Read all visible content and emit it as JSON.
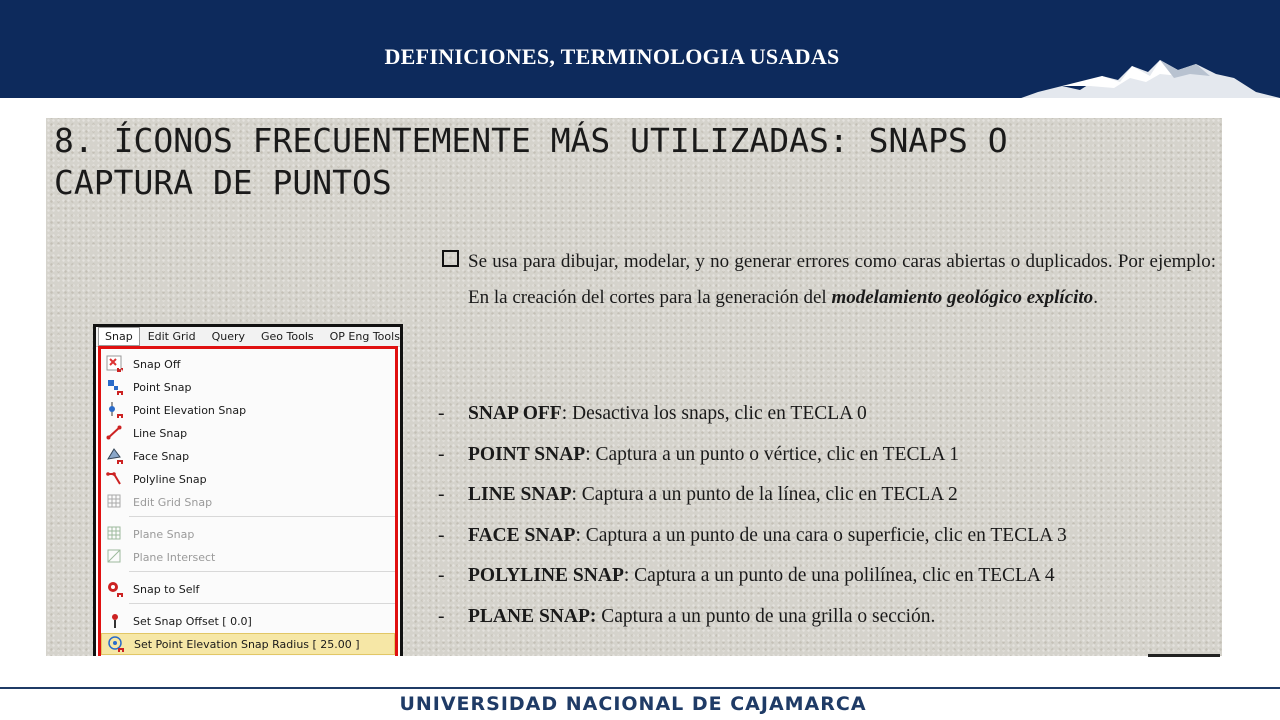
{
  "header": {
    "title": "DEFINICIONES, TERMINOLOGIA  USADAS"
  },
  "slide": {
    "title_line1": "8. ÍCONOS FRECUENTEMENTE MÁS UTILIZADAS: SNAPS O",
    "title_line2": "CAPTURA DE PUNTOS",
    "intro_prefix": "Se usa para dibujar, modelar, y no generar errores como caras abiertas o duplicados. Por ejemplo: En la creación del cortes para la generación del ",
    "intro_emph": "modelamiento geológico explícito",
    "intro_suffix": ".",
    "definitions": [
      {
        "term": "SNAP OFF",
        "desc": ": Desactiva los snaps, clic en TECLA 0"
      },
      {
        "term": "POINT SNAP",
        "desc": ": Captura a un punto o vértice, clic en TECLA 1"
      },
      {
        "term": "LINE SNAP",
        "desc": ": Captura a un punto de la línea, clic en TECLA 2"
      },
      {
        "term": "FACE SNAP",
        "desc": ": Captura a un punto de una cara o superficie, clic en TECLA 3"
      },
      {
        "term": "POLYLINE SNAP",
        "desc": ": Captura a un punto de una polilínea, clic en TECLA 4"
      },
      {
        "term": "PLANE SNAP:",
        "desc": " Captura a un punto de una grilla o sección."
      }
    ]
  },
  "menu": {
    "bar": [
      "Snap",
      "Edit Grid",
      "Query",
      "Geo Tools",
      "OP Eng Tools"
    ],
    "items": [
      {
        "label": "Snap Off",
        "icon": "snap-off-icon"
      },
      {
        "label": "Point Snap",
        "icon": "point-snap-icon"
      },
      {
        "label": "Point Elevation Snap",
        "icon": "point-elevation-snap-icon"
      },
      {
        "label": "Line Snap",
        "icon": "line-snap-icon"
      },
      {
        "label": "Face Snap",
        "icon": "face-snap-icon"
      },
      {
        "label": "Polyline Snap",
        "icon": "polyline-snap-icon"
      },
      {
        "label": "Edit Grid Snap",
        "icon": "edit-grid-snap-icon"
      },
      {
        "label": "Plane Snap",
        "icon": "plane-snap-icon"
      },
      {
        "label": "Plane Intersect",
        "icon": "plane-intersect-icon"
      },
      {
        "label": "Snap to Self",
        "icon": "snap-to-self-icon"
      },
      {
        "label": "Set Snap Offset [ 0.0]",
        "icon": "snap-offset-icon"
      },
      {
        "label": "Set Point Elevation Snap Radius [ 25.00 ]",
        "icon": "snap-radius-icon"
      }
    ]
  },
  "footer": {
    "text": "UNIVERSIDAD NACIONAL DE CAJAMARCA"
  }
}
